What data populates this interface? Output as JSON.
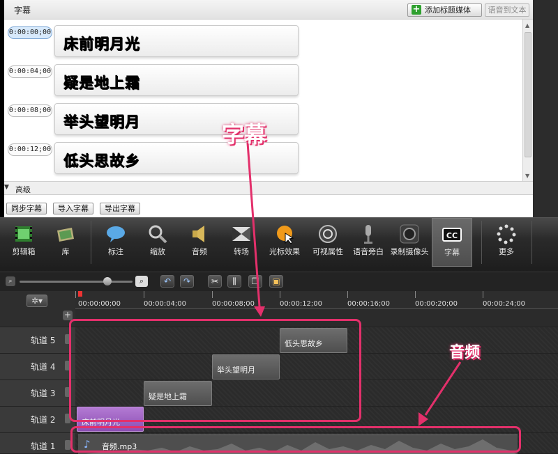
{
  "captions_panel": {
    "title": "字幕",
    "add_media_button": "添加标题媒体",
    "speech_to_text_button": "语音到文本",
    "entries": [
      {
        "time": "0:00:00;00",
        "text": "床前明月光",
        "selected": true
      },
      {
        "time": "0:00:04;00",
        "text": "疑是地上霜",
        "selected": false
      },
      {
        "time": "0:00:08;00",
        "text": "举头望明月",
        "selected": false
      },
      {
        "time": "0:00:12;00",
        "text": "低头思故乡",
        "selected": false
      }
    ],
    "advanced_label": "高级",
    "buttons": [
      "同步字幕",
      "导入字幕",
      "导出字幕"
    ]
  },
  "toolbar": {
    "tools": [
      {
        "label": "剪辑箱",
        "icon": "film-strip-icon"
      },
      {
        "label": "库",
        "icon": "library-icon"
      },
      {
        "label": "标注",
        "icon": "callout-icon"
      },
      {
        "label": "缩放",
        "icon": "magnifier-icon"
      },
      {
        "label": "音频",
        "icon": "speaker-icon"
      },
      {
        "label": "转场",
        "icon": "transition-icon"
      },
      {
        "label": "光标效果",
        "icon": "cursor-effect-icon"
      },
      {
        "label": "可视属性",
        "icon": "visual-properties-icon"
      },
      {
        "label": "语音旁白",
        "icon": "microphone-icon"
      },
      {
        "label": "录制摄像头",
        "icon": "camera-icon"
      },
      {
        "label": "字幕",
        "icon": "cc-icon",
        "active": true
      },
      {
        "label": "更多",
        "icon": "more-icon"
      }
    ]
  },
  "timeline": {
    "ruler_ticks": [
      "00:00:00;00",
      "00:00:04;00",
      "00:00:08;00",
      "00:00:12;00",
      "00:00:16;00",
      "00:00:20;00",
      "00:00:24;00"
    ],
    "tracks": [
      {
        "name": "轨道 5",
        "clip": "低头思故乡"
      },
      {
        "name": "轨道 4",
        "clip": "举头望明月"
      },
      {
        "name": "轨道 3",
        "clip": "疑是地上霜"
      },
      {
        "name": "轨道 2",
        "clip": "床前明月光"
      },
      {
        "name": "轨道 1",
        "clip": "音频.mp3"
      }
    ]
  },
  "annotations": {
    "captions": "字幕",
    "audio": "音频"
  },
  "colors": {
    "highlight": "#e3306b",
    "caption_clip_selected": "#a565c8",
    "audio_icon": "#8bb7ff"
  }
}
